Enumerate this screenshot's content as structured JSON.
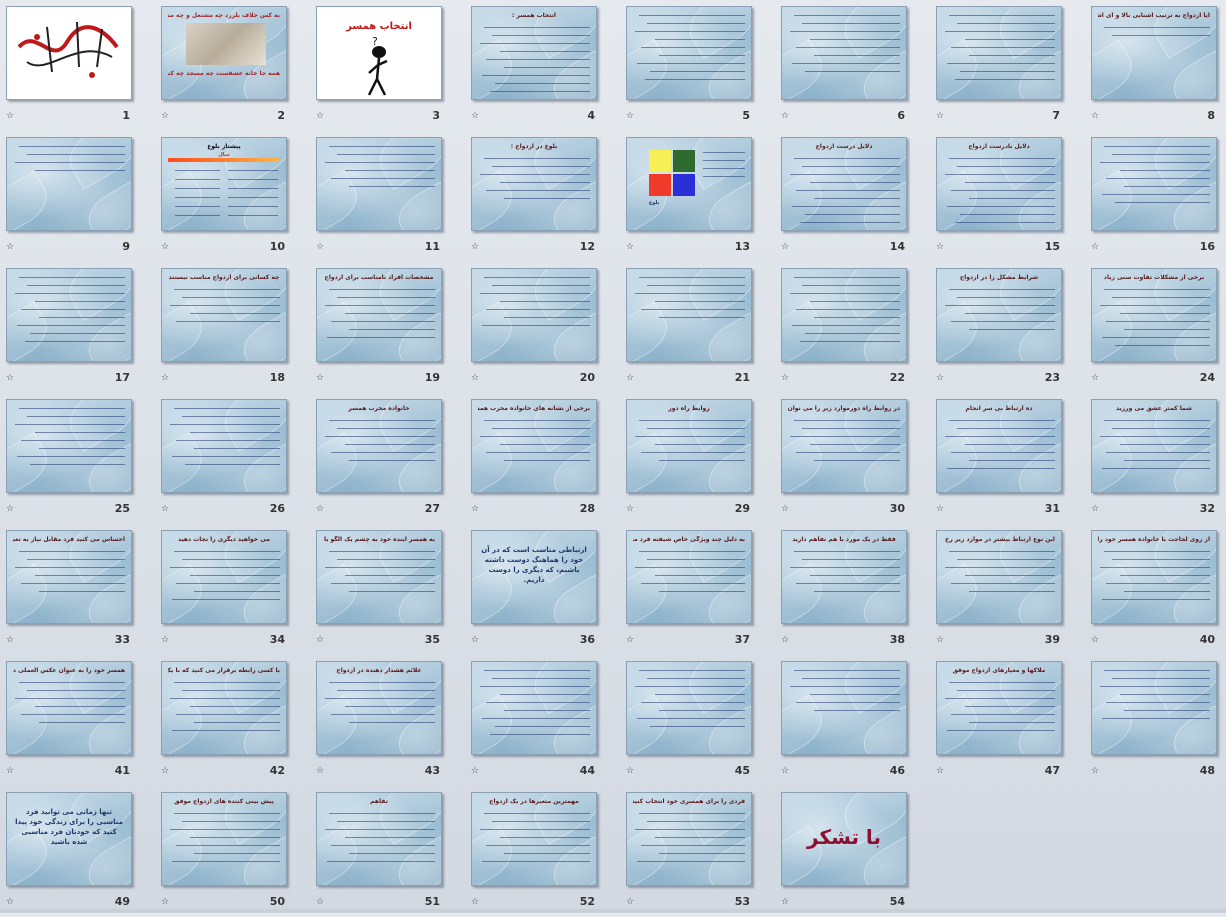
{
  "slides": [
    {
      "n": "1",
      "kind": "calligraphy",
      "title": ""
    },
    {
      "n": "2",
      "kind": "photo",
      "title": "به کس خلاف بلرزد چه مشتغل و چه مست",
      "title2": "همه جا خانه عشقست چه مسجد چه کنشت"
    },
    {
      "n": "3",
      "kind": "cartoon",
      "title": "انتخاب همسر"
    },
    {
      "n": "4",
      "kind": "text",
      "title": "انتخاب همسر :",
      "lines": 9
    },
    {
      "n": "5",
      "kind": "text",
      "title": "",
      "lines": 9
    },
    {
      "n": "6",
      "kind": "text",
      "title": "",
      "lines": 8
    },
    {
      "n": "7",
      "kind": "text",
      "title": "",
      "lines": 9
    },
    {
      "n": "8",
      "kind": "text",
      "title": "آیا ازدواج به ترتیب آشنایی بالا و ای آشنایی نشان چه ؟",
      "lines": 2
    },
    {
      "n": "9",
      "kind": "text",
      "title": "",
      "lines": 4
    },
    {
      "n": "10",
      "kind": "chart",
      "title": "پیشتاز بلوغ"
    },
    {
      "n": "11",
      "kind": "text",
      "title": "",
      "lines": 6
    },
    {
      "n": "12",
      "kind": "text",
      "title": "بلوغ در ازدواج :",
      "lines": 6
    },
    {
      "n": "13",
      "kind": "quad",
      "title": ""
    },
    {
      "n": "14",
      "kind": "text",
      "title": "دلایل درست ازدواج",
      "lines": 9
    },
    {
      "n": "15",
      "kind": "text",
      "title": "دلایل نادرست ازدواج",
      "lines": 9
    },
    {
      "n": "16",
      "kind": "text",
      "title": "",
      "lines": 8
    },
    {
      "n": "17",
      "kind": "text",
      "title": "",
      "lines": 9
    },
    {
      "n": "18",
      "kind": "text",
      "title": "چه کسانی برای ازدواج مناسب نیستند",
      "lines": 5
    },
    {
      "n": "19",
      "kind": "text",
      "title": "مشخصات افراد نامناسب برای ازدواج",
      "lines": 7
    },
    {
      "n": "20",
      "kind": "text",
      "title": "",
      "lines": 7
    },
    {
      "n": "21",
      "kind": "text",
      "title": "",
      "lines": 6
    },
    {
      "n": "22",
      "kind": "text",
      "title": "",
      "lines": 9
    },
    {
      "n": "23",
      "kind": "text",
      "title": "شرایط مشکل زا در ازدواج",
      "lines": 6
    },
    {
      "n": "24",
      "kind": "text",
      "title": "برخی از مشکلات تفاوت سنی زیاد",
      "lines": 8
    },
    {
      "n": "25",
      "kind": "text",
      "title": "",
      "lines": 8
    },
    {
      "n": "26",
      "kind": "text",
      "title": "",
      "lines": 8
    },
    {
      "n": "27",
      "kind": "text",
      "title": "خانواده مخرب همسر",
      "lines": 6
    },
    {
      "n": "28",
      "kind": "text",
      "title": "برخی از نشانه های خانواده مخرب همسر",
      "lines": 6
    },
    {
      "n": "29",
      "kind": "text",
      "title": "روابط راه دور",
      "lines": 6
    },
    {
      "n": "30",
      "kind": "text",
      "title": "در روابط راه دورموارد زیر را می توان مشاهده کرد",
      "lines": 6
    },
    {
      "n": "31",
      "kind": "text",
      "title": "ده ارتباط بی سر انجام",
      "lines": 7
    },
    {
      "n": "32",
      "kind": "text",
      "title": "شما کمتر عشق می ورزید",
      "lines": 7
    },
    {
      "n": "33",
      "kind": "text",
      "title": "احساس می کنید فرد مقابل نیاز به تغییر دارد",
      "lines": 6
    },
    {
      "n": "34",
      "kind": "text",
      "title": "می خواهید دیگری را نجات دهید",
      "lines": 7
    },
    {
      "n": "35",
      "kind": "text",
      "title": "به همسر آینده خود به چشم یک الگو یا یک آموزگار نگاه می کنید",
      "lines": 6
    },
    {
      "n": "36",
      "kind": "text",
      "title": "ارتباطی مناسب است که در آن خود را هماهنگ دوست داشته باشیم، که دیگری را دوست داریم.",
      "lines": 0
    },
    {
      "n": "37",
      "kind": "text",
      "title": "به دلیل چند ویژگی خاص شیفته فرد مقابل شده اید",
      "lines": 6
    },
    {
      "n": "38",
      "kind": "text",
      "title": "فقط در یک مورد با هم تفاهم دارید",
      "lines": 6
    },
    {
      "n": "39",
      "kind": "text",
      "title": "این نوع ارتباط بیشتر در موارد زیر رخ می دهد",
      "lines": 6
    },
    {
      "n": "40",
      "kind": "text",
      "title": "از روی لجاجت با خانواده همسر خود را انتخاب کرده اید",
      "lines": 7
    },
    {
      "n": "41",
      "kind": "text",
      "title": "همسر خود را به عنوان عکس العملی در قبال تلاوه قبلی خود انتخاب کرده اید",
      "lines": 6
    },
    {
      "n": "42",
      "kind": "text",
      "title": "با کسی رابطه برقرار می کنید که با یک نفر دیگر است",
      "lines": 7
    },
    {
      "n": "43",
      "kind": "text",
      "title": "علائم هشدار دهنده در ازدواج",
      "lines": 6
    },
    {
      "n": "44",
      "kind": "text",
      "title": "",
      "lines": 9
    },
    {
      "n": "45",
      "kind": "text",
      "title": "",
      "lines": 8
    },
    {
      "n": "46",
      "kind": "text",
      "title": "",
      "lines": 6
    },
    {
      "n": "47",
      "kind": "text",
      "title": "ملاکها و معیارهای ازدواج موفق",
      "lines": 7
    },
    {
      "n": "48",
      "kind": "text",
      "title": "",
      "lines": 7
    },
    {
      "n": "49",
      "kind": "text",
      "title": "تنها زمانی می توانید فرد مناسبی را برای زندگی خود پیدا کنید که خودتان فرد مناسبی شده باشید",
      "lines": 0
    },
    {
      "n": "50",
      "kind": "text",
      "title": "پیش بینی کننده های ازدواج موفق",
      "lines": 7
    },
    {
      "n": "51",
      "kind": "text",
      "title": "تفاهم",
      "lines": 7
    },
    {
      "n": "52",
      "kind": "text",
      "title": "مهمترین متغیرها در یک ازدواج",
      "lines": 7
    },
    {
      "n": "53",
      "kind": "text",
      "title": "فردی را برای همسری خود انتخاب کنید که :",
      "lines": 7
    },
    {
      "n": "54",
      "kind": "thanks",
      "title": "با تشکر"
    }
  ],
  "slide10": {
    "header": "پیشتاز بلوغ",
    "bar_label": "سال"
  },
  "slide13": {
    "caption": "بلوغ"
  },
  "colors": {
    "title": "#5a1a1a",
    "body": "#22386e",
    "thanks": "#8b1030"
  }
}
